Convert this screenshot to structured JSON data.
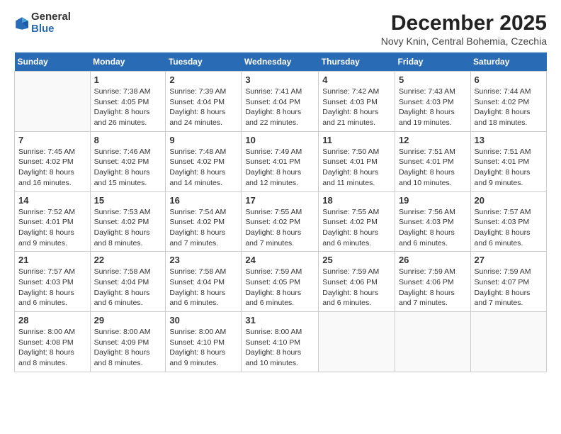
{
  "header": {
    "logo_general": "General",
    "logo_blue": "Blue",
    "title": "December 2025",
    "subtitle": "Novy Knin, Central Bohemia, Czechia"
  },
  "days_of_week": [
    "Sunday",
    "Monday",
    "Tuesday",
    "Wednesday",
    "Thursday",
    "Friday",
    "Saturday"
  ],
  "weeks": [
    [
      {
        "day": "",
        "sunrise": "",
        "sunset": "",
        "daylight": ""
      },
      {
        "day": "1",
        "sunrise": "Sunrise: 7:38 AM",
        "sunset": "Sunset: 4:05 PM",
        "daylight": "Daylight: 8 hours and 26 minutes."
      },
      {
        "day": "2",
        "sunrise": "Sunrise: 7:39 AM",
        "sunset": "Sunset: 4:04 PM",
        "daylight": "Daylight: 8 hours and 24 minutes."
      },
      {
        "day": "3",
        "sunrise": "Sunrise: 7:41 AM",
        "sunset": "Sunset: 4:04 PM",
        "daylight": "Daylight: 8 hours and 22 minutes."
      },
      {
        "day": "4",
        "sunrise": "Sunrise: 7:42 AM",
        "sunset": "Sunset: 4:03 PM",
        "daylight": "Daylight: 8 hours and 21 minutes."
      },
      {
        "day": "5",
        "sunrise": "Sunrise: 7:43 AM",
        "sunset": "Sunset: 4:03 PM",
        "daylight": "Daylight: 8 hours and 19 minutes."
      },
      {
        "day": "6",
        "sunrise": "Sunrise: 7:44 AM",
        "sunset": "Sunset: 4:02 PM",
        "daylight": "Daylight: 8 hours and 18 minutes."
      }
    ],
    [
      {
        "day": "7",
        "sunrise": "Sunrise: 7:45 AM",
        "sunset": "Sunset: 4:02 PM",
        "daylight": "Daylight: 8 hours and 16 minutes."
      },
      {
        "day": "8",
        "sunrise": "Sunrise: 7:46 AM",
        "sunset": "Sunset: 4:02 PM",
        "daylight": "Daylight: 8 hours and 15 minutes."
      },
      {
        "day": "9",
        "sunrise": "Sunrise: 7:48 AM",
        "sunset": "Sunset: 4:02 PM",
        "daylight": "Daylight: 8 hours and 14 minutes."
      },
      {
        "day": "10",
        "sunrise": "Sunrise: 7:49 AM",
        "sunset": "Sunset: 4:01 PM",
        "daylight": "Daylight: 8 hours and 12 minutes."
      },
      {
        "day": "11",
        "sunrise": "Sunrise: 7:50 AM",
        "sunset": "Sunset: 4:01 PM",
        "daylight": "Daylight: 8 hours and 11 minutes."
      },
      {
        "day": "12",
        "sunrise": "Sunrise: 7:51 AM",
        "sunset": "Sunset: 4:01 PM",
        "daylight": "Daylight: 8 hours and 10 minutes."
      },
      {
        "day": "13",
        "sunrise": "Sunrise: 7:51 AM",
        "sunset": "Sunset: 4:01 PM",
        "daylight": "Daylight: 8 hours and 9 minutes."
      }
    ],
    [
      {
        "day": "14",
        "sunrise": "Sunrise: 7:52 AM",
        "sunset": "Sunset: 4:01 PM",
        "daylight": "Daylight: 8 hours and 9 minutes."
      },
      {
        "day": "15",
        "sunrise": "Sunrise: 7:53 AM",
        "sunset": "Sunset: 4:02 PM",
        "daylight": "Daylight: 8 hours and 8 minutes."
      },
      {
        "day": "16",
        "sunrise": "Sunrise: 7:54 AM",
        "sunset": "Sunset: 4:02 PM",
        "daylight": "Daylight: 8 hours and 7 minutes."
      },
      {
        "day": "17",
        "sunrise": "Sunrise: 7:55 AM",
        "sunset": "Sunset: 4:02 PM",
        "daylight": "Daylight: 8 hours and 7 minutes."
      },
      {
        "day": "18",
        "sunrise": "Sunrise: 7:55 AM",
        "sunset": "Sunset: 4:02 PM",
        "daylight": "Daylight: 8 hours and 6 minutes."
      },
      {
        "day": "19",
        "sunrise": "Sunrise: 7:56 AM",
        "sunset": "Sunset: 4:03 PM",
        "daylight": "Daylight: 8 hours and 6 minutes."
      },
      {
        "day": "20",
        "sunrise": "Sunrise: 7:57 AM",
        "sunset": "Sunset: 4:03 PM",
        "daylight": "Daylight: 8 hours and 6 minutes."
      }
    ],
    [
      {
        "day": "21",
        "sunrise": "Sunrise: 7:57 AM",
        "sunset": "Sunset: 4:03 PM",
        "daylight": "Daylight: 8 hours and 6 minutes."
      },
      {
        "day": "22",
        "sunrise": "Sunrise: 7:58 AM",
        "sunset": "Sunset: 4:04 PM",
        "daylight": "Daylight: 8 hours and 6 minutes."
      },
      {
        "day": "23",
        "sunrise": "Sunrise: 7:58 AM",
        "sunset": "Sunset: 4:04 PM",
        "daylight": "Daylight: 8 hours and 6 minutes."
      },
      {
        "day": "24",
        "sunrise": "Sunrise: 7:59 AM",
        "sunset": "Sunset: 4:05 PM",
        "daylight": "Daylight: 8 hours and 6 minutes."
      },
      {
        "day": "25",
        "sunrise": "Sunrise: 7:59 AM",
        "sunset": "Sunset: 4:06 PM",
        "daylight": "Daylight: 8 hours and 6 minutes."
      },
      {
        "day": "26",
        "sunrise": "Sunrise: 7:59 AM",
        "sunset": "Sunset: 4:06 PM",
        "daylight": "Daylight: 8 hours and 7 minutes."
      },
      {
        "day": "27",
        "sunrise": "Sunrise: 7:59 AM",
        "sunset": "Sunset: 4:07 PM",
        "daylight": "Daylight: 8 hours and 7 minutes."
      }
    ],
    [
      {
        "day": "28",
        "sunrise": "Sunrise: 8:00 AM",
        "sunset": "Sunset: 4:08 PM",
        "daylight": "Daylight: 8 hours and 8 minutes."
      },
      {
        "day": "29",
        "sunrise": "Sunrise: 8:00 AM",
        "sunset": "Sunset: 4:09 PM",
        "daylight": "Daylight: 8 hours and 8 minutes."
      },
      {
        "day": "30",
        "sunrise": "Sunrise: 8:00 AM",
        "sunset": "Sunset: 4:10 PM",
        "daylight": "Daylight: 8 hours and 9 minutes."
      },
      {
        "day": "31",
        "sunrise": "Sunrise: 8:00 AM",
        "sunset": "Sunset: 4:10 PM",
        "daylight": "Daylight: 8 hours and 10 minutes."
      },
      {
        "day": "",
        "sunrise": "",
        "sunset": "",
        "daylight": ""
      },
      {
        "day": "",
        "sunrise": "",
        "sunset": "",
        "daylight": ""
      },
      {
        "day": "",
        "sunrise": "",
        "sunset": "",
        "daylight": ""
      }
    ]
  ]
}
